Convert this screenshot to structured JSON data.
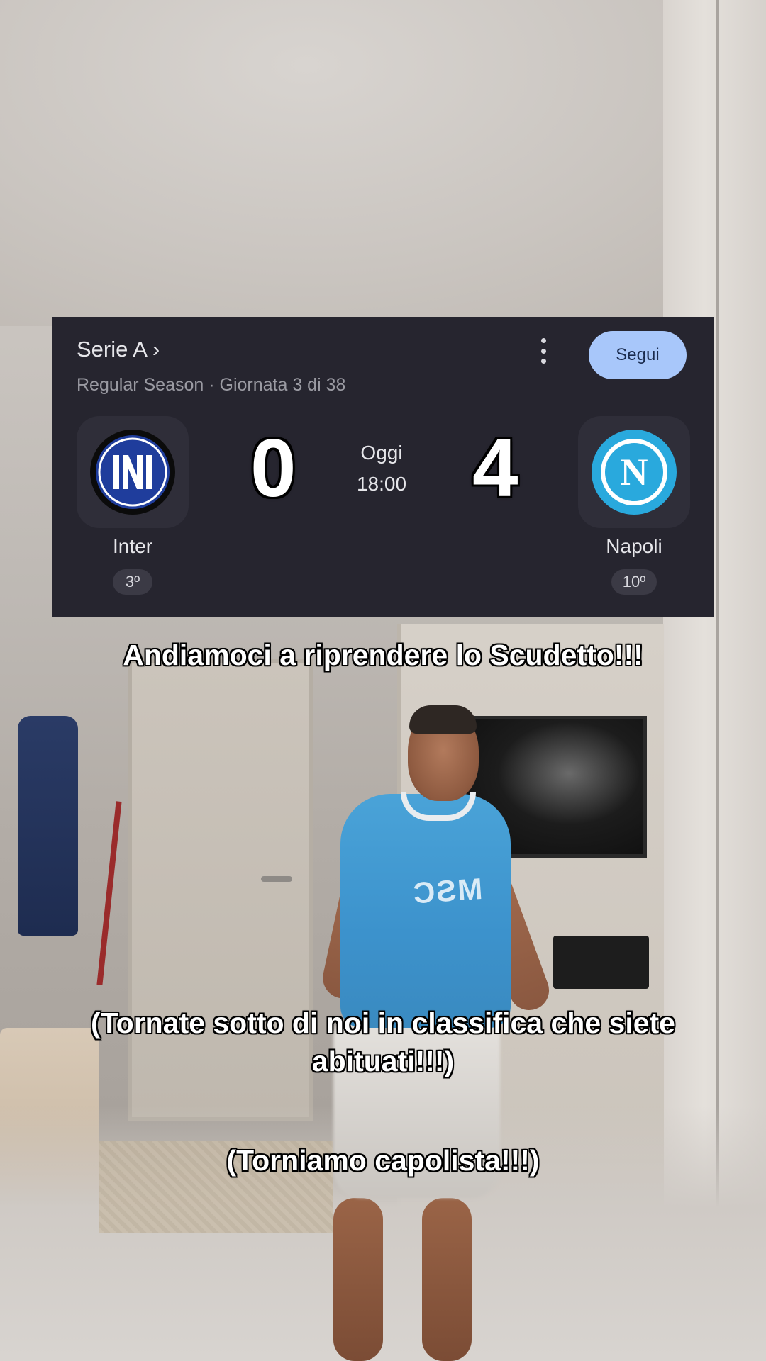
{
  "scorecard": {
    "competition": "Serie A ›",
    "round": "Regular Season · Giornata 3 di 38",
    "follow_label": "Segui",
    "more_icon": "more-vert-icon",
    "home_team": {
      "name": "Inter",
      "rank": "3º",
      "score": "0",
      "crest_color": "#1f3d9c"
    },
    "away_team": {
      "name": "Napoli",
      "rank": "10º",
      "score": "4",
      "crest_color": "#29a9dd"
    },
    "date_label": "Oggi",
    "time_label": "18:00"
  },
  "captions": {
    "line1": "Andiamoci a riprendere lo Scudetto!!!",
    "line2": "(Tornate sotto di noi in classifica che siete abituati!!!)",
    "line3": "(Torniamo capolista!!!)"
  },
  "colors": {
    "card_background": "#26252f",
    "follow_button": "#a8c7fa",
    "text_primary": "#e6e6ea",
    "text_secondary": "#9a9aa2"
  }
}
